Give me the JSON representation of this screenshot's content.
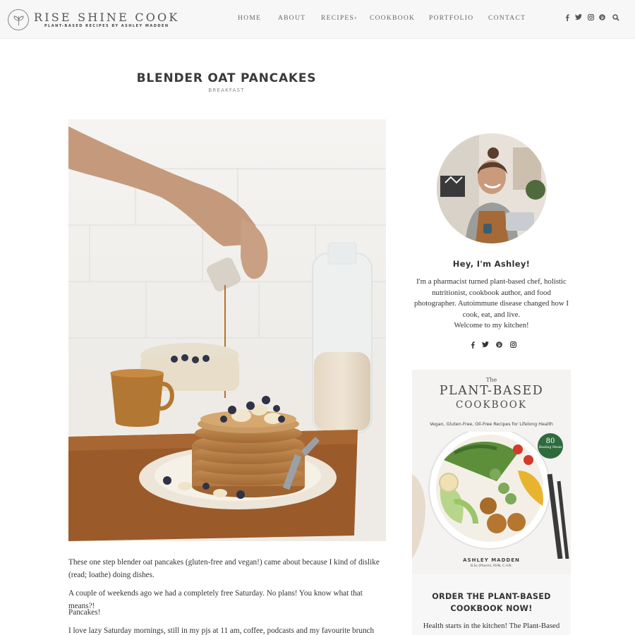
{
  "site": {
    "title": "RISE SHINE COOK",
    "tagline": "PLANT-BASED RECIPES BY ASHLEY MADDEN"
  },
  "nav": {
    "items": [
      "HOME",
      "ABOUT",
      "RECIPES",
      "COOKBOOK",
      "PORTFOLIO",
      "CONTACT"
    ],
    "recipes_caret": "›"
  },
  "social_icons": [
    "facebook-icon",
    "twitter-icon",
    "instagram-icon",
    "pinterest-icon",
    "search-icon"
  ],
  "post": {
    "title": "BLENDER OAT PANCAKES",
    "category": "BREAKFAST",
    "hero_icon": "pancake-stack-photo",
    "paragraphs": [
      "These one step blender oat pancakes (gluten-free and vegan!) came about because I kind of dislike (read; loathe) doing dishes.",
      "A couple of weekends ago we had a completely free Saturday. No plans! You know what that means?!",
      "Pancakes!",
      "I love lazy Saturday mornings, still in my pjs at 11 am, coffee, podcasts and my favourite brunch food;"
    ]
  },
  "sidebar": {
    "greeting": "Hey, I'm Ashley!",
    "bio": "I'm a pharmacist turned plant-based chef, holistic nutritionist, cookbook author, and food photographer. Autoimmune disease changed how I cook, eat, and live.",
    "welcome": "Welcome to my kitchen!",
    "social_icons": [
      "facebook-icon",
      "twitter-icon",
      "pinterest-icon",
      "instagram-icon"
    ],
    "book": {
      "the": "The",
      "title_line1": "PLANT-BASED",
      "title_line2": "COOKBOOK",
      "subtitle": "Vegan, Gluten-Free, Oil-Free Recipes for Lifelong Health",
      "badge_number": "80",
      "badge_text": "Healing Meals",
      "author": "ASHLEY MADDEN",
      "credentials": "B.Sc.(Pharm), RHN, C.H.N."
    },
    "order": {
      "title_line1": "ORDER THE PLANT-BASED",
      "title_line2": "COOKBOOK NOW!",
      "text": "Health starts in the kitchen! The Plant-Based"
    }
  }
}
